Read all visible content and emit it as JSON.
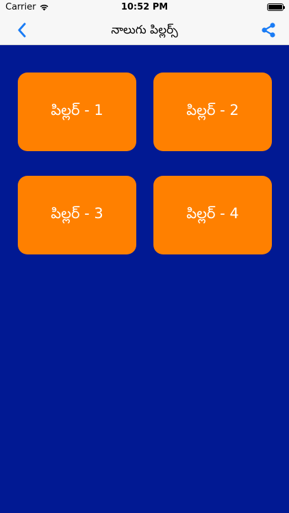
{
  "status_bar": {
    "carrier": "Carrier",
    "time": "10:52 PM",
    "wifi_icon": "wifi-icon",
    "battery_level": 1.0
  },
  "nav": {
    "title": "నాలుగు పిల్లర్స్",
    "back_icon": "chevron-left-icon",
    "share_icon": "share-icon",
    "accent_color": "#1a7cf5"
  },
  "tiles": [
    {
      "label": "పిల్లర్ - 1"
    },
    {
      "label": "పిల్లర్ - 2"
    },
    {
      "label": "పిల్లర్ - 3"
    },
    {
      "label": "పిల్లర్ - 4"
    }
  ],
  "colors": {
    "background": "#011993",
    "tile": "#ff8000",
    "tile_text": "#ffffff"
  }
}
